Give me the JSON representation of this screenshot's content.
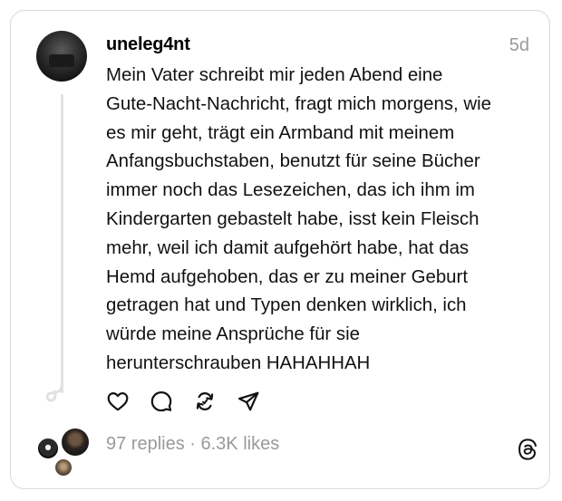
{
  "post": {
    "username": "uneleg4nt",
    "timestamp": "5d",
    "body_lines": [
      "Mein Vater schreibt mir jeden Abend eine",
      "Gute-Nacht-Nachricht, fragt mich morgens, wie",
      "es mir geht, trägt ein Armband mit meinem",
      "Anfangsbuchstaben, benutzt für seine Bücher",
      "immer noch das Lesezeichen, das ich ihm im",
      "Kindergarten gebastelt habe, isst kein Fleisch",
      "mehr, weil ich damit aufgehört habe, hat das",
      "Hemd aufgehoben, das er zu meiner Geburt",
      "getragen hat und Typen denken wirklich, ich",
      "würde meine Ansprüche für sie",
      "herunterschrauben HAHAHHAH"
    ]
  },
  "actions": [
    {
      "name": "like",
      "icon": "heart-icon"
    },
    {
      "name": "reply",
      "icon": "comment-icon"
    },
    {
      "name": "repost",
      "icon": "repost-icon"
    },
    {
      "name": "share",
      "icon": "send-icon"
    }
  ],
  "stats": {
    "text": "97 replies · 6.3K likes"
  },
  "icons": {
    "brand": "threads-logo-icon"
  },
  "colors": {
    "text": "#111111",
    "muted": "#9a9a9a",
    "border": "#dadada",
    "thread_line": "#e1e1e1"
  }
}
